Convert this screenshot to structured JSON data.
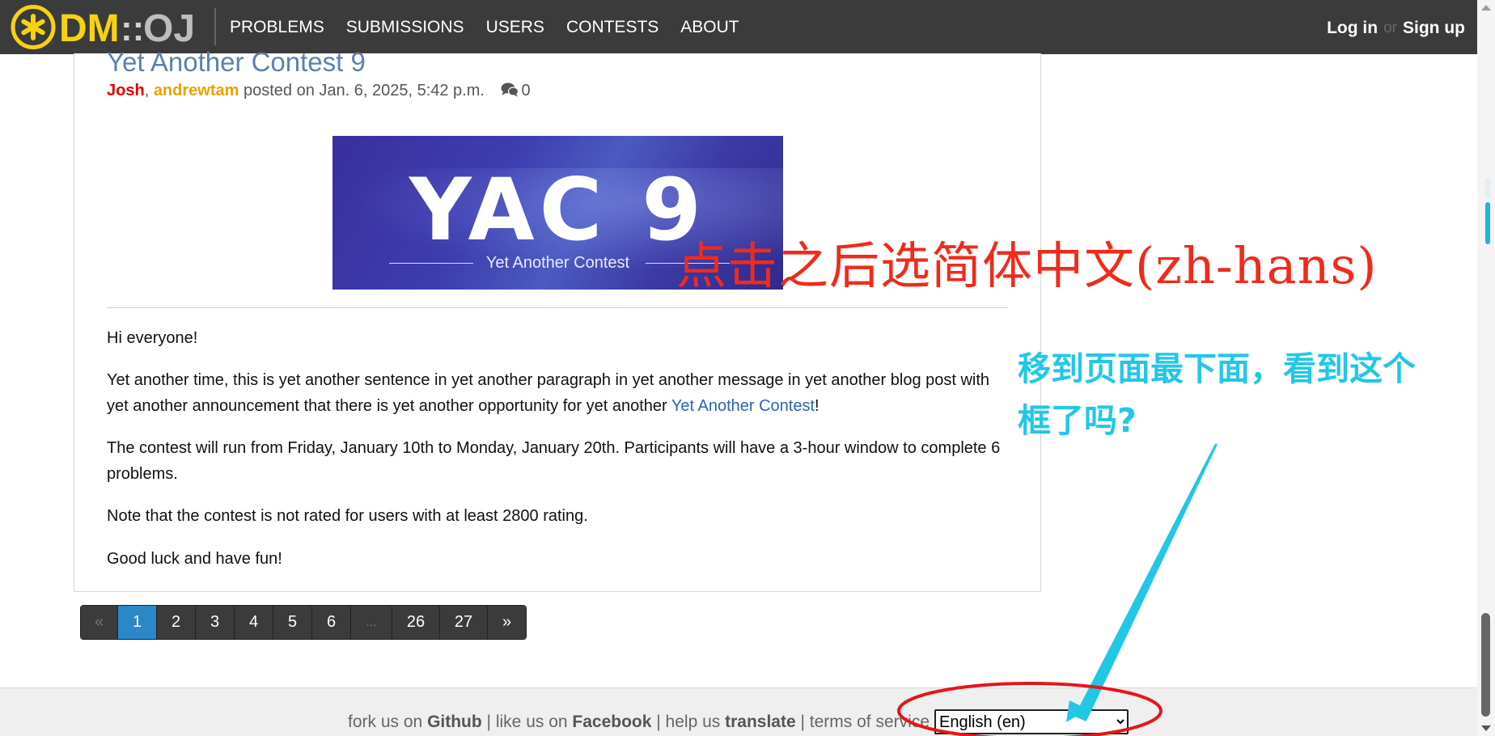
{
  "nav": {
    "logo_dm": "DM",
    "logo_sep": "::",
    "logo_oj": "OJ",
    "links": [
      "PROBLEMS",
      "SUBMISSIONS",
      "USERS",
      "CONTESTS",
      "ABOUT"
    ],
    "login": "Log in",
    "or": "or",
    "signup": "Sign up"
  },
  "post": {
    "title": "Yet Another Contest 9",
    "author_1": "Josh",
    "author_sep": ", ",
    "author_2": "andrewtam",
    "posted_on": " posted on Jan. 6, 2025, 5:42 p.m.",
    "comment_count": "0",
    "banner_title": "YAC 9",
    "banner_subtitle": "Yet Another Contest",
    "para_1": "Hi everyone!",
    "para_2_before": "Yet another time, this is yet another sentence in yet another paragraph in yet another message in yet another blog post with yet another announcement that there is yet another opportunity for yet another ",
    "para_2_link": "Yet Another Contest",
    "para_2_after": "!",
    "para_3": "The contest will run from Friday, January 10th to Monday, January 20th. Participants will have a 3-hour window to complete 6 problems.",
    "para_4": "Note that the contest is not rated for users with at least 2800 rating.",
    "para_5": "Good luck and have fun!"
  },
  "pagination": {
    "prev": "«",
    "pages": [
      "1",
      "2",
      "3",
      "4",
      "5",
      "6",
      "...",
      "26",
      "27"
    ],
    "next": "»",
    "current": "1"
  },
  "footer": {
    "fork_prefix": "fork us on ",
    "github": "Github",
    "like_prefix": " | like us on ",
    "facebook": "Facebook",
    "help_prefix": " | help us ",
    "translate": "translate",
    "terms": " | terms of service | ",
    "language_selected": "English (en)"
  },
  "annotations": {
    "red_text": "点击之后选简体中文(zh-hans)",
    "cyan_text": "移到页面最下面，看到这个框了吗?"
  },
  "colors": {
    "navbar": "#3b3b3b",
    "title_link": "#5b80b2",
    "author_red": "#e00000",
    "author_orange": "#e8a300",
    "page_active": "#2b87c7",
    "annotation_red": "#ef2b1c",
    "annotation_cyan": "#22c7e6",
    "logo_yellow": "#f5d312"
  }
}
